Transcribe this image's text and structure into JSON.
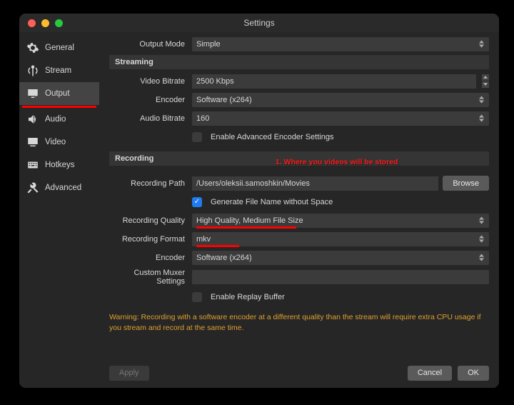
{
  "title": "Settings",
  "sidebar": {
    "items": [
      {
        "label": "General"
      },
      {
        "label": "Stream"
      },
      {
        "label": "Output"
      },
      {
        "label": "Audio"
      },
      {
        "label": "Video"
      },
      {
        "label": "Hotkeys"
      },
      {
        "label": "Advanced"
      }
    ]
  },
  "output_mode": {
    "label": "Output Mode",
    "value": "Simple"
  },
  "streaming": {
    "header": "Streaming",
    "video_bitrate": {
      "label": "Video Bitrate",
      "value": "2500 Kbps"
    },
    "encoder": {
      "label": "Encoder",
      "value": "Software (x264)"
    },
    "audio_bitrate": {
      "label": "Audio Bitrate",
      "value": "160"
    },
    "enable_advanced": {
      "label": "Enable Advanced Encoder Settings",
      "checked": false
    }
  },
  "recording": {
    "header": "Recording",
    "annotation": "1. Where you videos will be stored",
    "path": {
      "label": "Recording Path",
      "value": "/Users/oleksii.samoshkin/Movies"
    },
    "browse": "Browse",
    "gen_no_space": {
      "label": "Generate File Name without Space",
      "checked": true
    },
    "quality": {
      "label": "Recording Quality",
      "value": "High Quality, Medium File Size"
    },
    "format": {
      "label": "Recording Format",
      "value": "mkv"
    },
    "encoder": {
      "label": "Encoder",
      "value": "Software (x264)"
    },
    "muxer": {
      "label": "Custom Muxer Settings",
      "value": ""
    },
    "replay_buffer": {
      "label": "Enable Replay Buffer",
      "checked": false
    }
  },
  "warning": "Warning: Recording with a software encoder at a different quality than the stream will require extra CPU usage if you stream and record at the same time.",
  "footer": {
    "apply": "Apply",
    "cancel": "Cancel",
    "ok": "OK"
  }
}
